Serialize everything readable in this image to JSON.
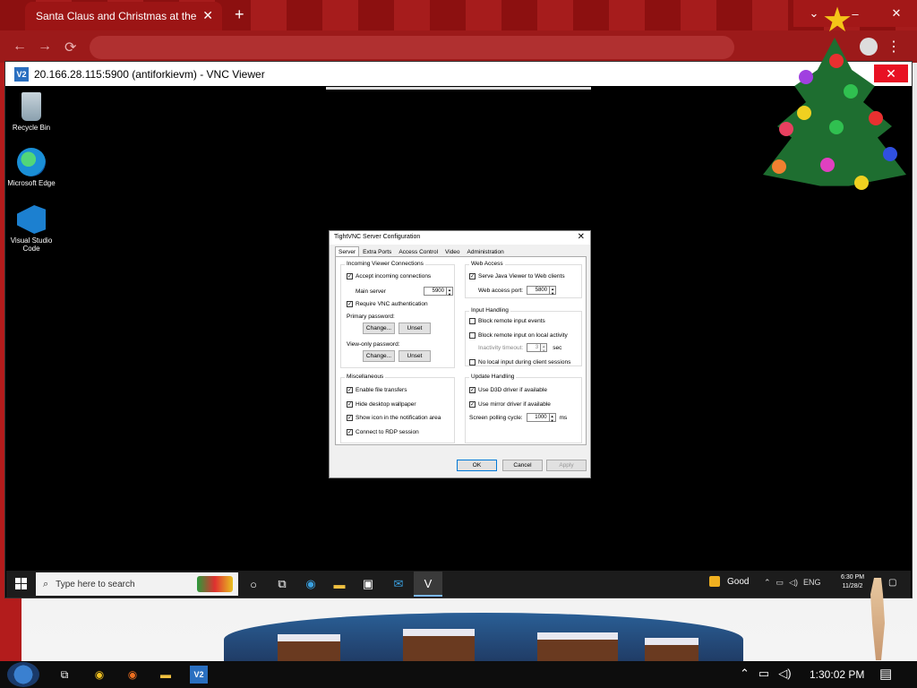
{
  "browser": {
    "tab_title": "Santa Claus and Christmas at the",
    "tab_close": "✕",
    "new_tab": "+",
    "minimize": "⌄",
    "restore": "–",
    "close": "✕"
  },
  "vnc": {
    "logo": "V2",
    "title": "20.166.28.115:5900 (antiforkievm) - VNC Viewer",
    "close": "✕"
  },
  "desktop_icons": [
    {
      "label": "Recycle Bin",
      "icon": "recycle-bin-icon"
    },
    {
      "label": "Microsoft Edge",
      "icon": "edge-icon"
    },
    {
      "label": "Visual Studio Code",
      "icon": "vscode-icon"
    }
  ],
  "dialog": {
    "title": "TightVNC Server Configuration",
    "close": "✕",
    "tabs": [
      "Server",
      "Extra Ports",
      "Access Control",
      "Video",
      "Administration"
    ],
    "incoming": {
      "title": "Incoming Viewer Connections",
      "accept_label": "Accept incoming connections",
      "main_server_label": "Main server",
      "main_server_value": "5900",
      "require_auth_label": "Require VNC authentication",
      "primary_password_label": "Primary password:",
      "viewonly_password_label": "View-only password:",
      "change_label": "Change...",
      "unset_label": "Unset"
    },
    "misc": {
      "title": "Miscellaneous",
      "file_transfers": "Enable file transfers",
      "hide_wallpaper": "Hide desktop wallpaper",
      "show_icon": "Show icon in the notification area",
      "connect_rdp": "Connect to RDP session"
    },
    "web": {
      "title": "Web Access",
      "serve_java": "Serve Java Viewer to Web clients",
      "port_label": "Web access port:",
      "port_value": "5800"
    },
    "input": {
      "title": "Input Handling",
      "block_remote": "Block remote input events",
      "block_local": "Block remote input on local activity",
      "timeout_label": "Inactivity timeout:",
      "timeout_value": "3",
      "timeout_unit": "sec",
      "no_local": "No local input during client sessions"
    },
    "update": {
      "title": "Update Handling",
      "d3d": "Use D3D driver if available",
      "mirror": "Use mirror driver if available",
      "polling_label": "Screen polling cycle:",
      "polling_value": "1000",
      "polling_unit": "ms"
    },
    "ok": "OK",
    "cancel": "Cancel",
    "apply": "Apply",
    "checked_mark": "✓",
    "spin_up": "▲",
    "spin_down": "▼"
  },
  "remote_taskbar": {
    "search_placeholder": "Type here to search",
    "weather": "Good",
    "lang": "ENG",
    "time": "6:30 PM",
    "date": "11/28/2"
  },
  "host_taskbar": {
    "time": "1:30:02 PM"
  }
}
